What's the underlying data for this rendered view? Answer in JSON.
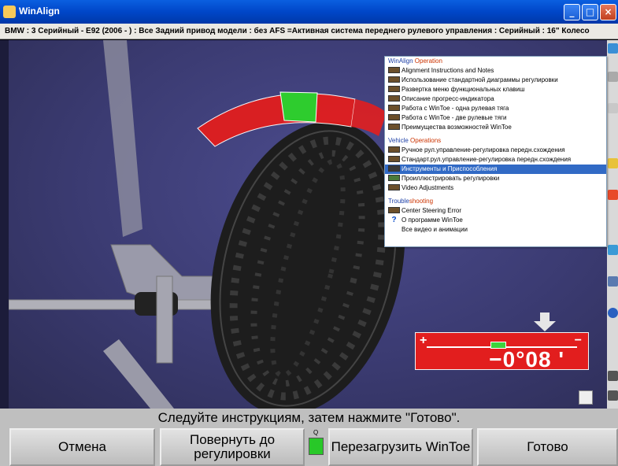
{
  "window": {
    "title": "WinAlign",
    "subtitle": "BMW : 3 Серийный - E92 (2006 -    ) : Все Задний привод модели : без AFS =Активная система переднего рулевого управления : Серийный : 16\" Колесо"
  },
  "help_menu": {
    "sections": [
      {
        "heading_prefix": "WinAlign",
        "heading_suffix": " Operation",
        "items": [
          "Alignment Instructions and Notes",
          "Использование стандартной диаграммы регулировки",
          "Развертка меню функциональных клавиш",
          "Описание прогресс-индикатора",
          "Работа с WinToe - одна рулевая тяга",
          "Работа с WinToe - две рулевые тяги",
          "Преимущества возможностей WinToe"
        ]
      },
      {
        "heading_prefix": "Vehicle",
        "heading_suffix": " Operations",
        "items": [
          "Ручное рул.управление-регулировка передн.схождения",
          "Стандарт.рул.управление-регулировка передн.схождения",
          "Инструменты и Приспособления",
          "Проиллюстрировать регулировки",
          "Video Adjustments"
        ],
        "selected_index": 2
      },
      {
        "heading_prefix": "Trouble",
        "heading_suffix": "shooting",
        "items": [
          "Center Steering Error",
          "О программе WinToe",
          "Все видео и анимации"
        ]
      }
    ]
  },
  "readout": {
    "plus": "+",
    "minus": "−",
    "value": "−0°08 '"
  },
  "instruction": "Следуйте инструкциям, затем нажмите \"Готово\".",
  "buttons": {
    "cancel": "Отмена",
    "rotate": "Повернуть до регулировки",
    "q_label": "Q",
    "restart": "Перезагрузить WinToe",
    "done": "Готово"
  },
  "colors": {
    "window_blue": "#0046c8",
    "gauge_red": "#e21e1e",
    "gauge_green": "#3cd33c",
    "selection": "#316ac5"
  }
}
